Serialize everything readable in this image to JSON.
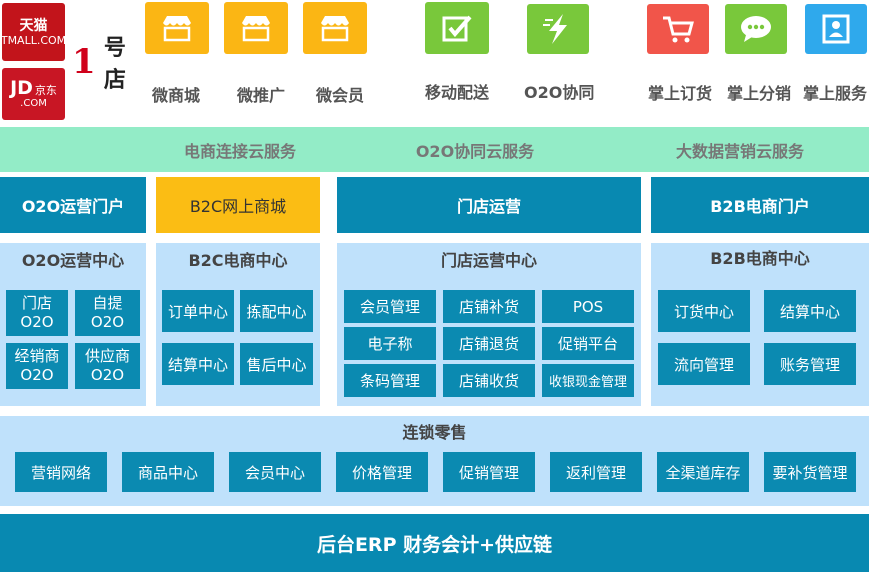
{
  "logos": {
    "tmall_cn": "天猫",
    "tmall_en": "TMALL.COM",
    "jd_en": "JD",
    "jd_cn": "京东",
    "jd_com": ".COM",
    "yhd_one": "1",
    "yhd_rest": "号店"
  },
  "channels": [
    {
      "label": "微商城",
      "icon": "storefront-icon",
      "color": "#fbb614"
    },
    {
      "label": "微推广",
      "icon": "storefront-icon",
      "color": "#fbb614"
    },
    {
      "label": "微会员",
      "icon": "storefront-icon",
      "color": "#fbb614"
    },
    {
      "label": "移动配送",
      "icon": "checkbox-icon",
      "color": "#79c83b"
    },
    {
      "label": "O2O协同",
      "icon": "lightning-icon",
      "color": "#79c83b"
    },
    {
      "label": "掌上订货",
      "icon": "cart-icon",
      "color": "#f1554a"
    },
    {
      "label": "掌上分销",
      "icon": "chat-icon",
      "color": "#79c83b"
    },
    {
      "label": "掌上服务",
      "icon": "contact-card-icon",
      "color": "#2fa9ec"
    }
  ],
  "cloud_services": [
    "电商连接云服务",
    "O2O协同云服务",
    "大数据营销云服务"
  ],
  "portals": [
    "O2O运营门户",
    "B2C网上商城",
    "门店运营",
    "B2B电商门户"
  ],
  "centers": {
    "o2o": {
      "title": "O2O运营中心",
      "items": [
        [
          "门店",
          "O2O"
        ],
        [
          "自提",
          "O2O"
        ],
        [
          "经销商",
          "O2O"
        ],
        [
          "供应商",
          "O2O"
        ]
      ]
    },
    "b2c": {
      "title": "B2C电商中心",
      "items": [
        "订单中心",
        "拣配中心",
        "结算中心",
        "售后中心"
      ]
    },
    "store": {
      "title": "门店运营中心",
      "items": [
        "会员管理",
        "店铺补货",
        "POS",
        "电子称",
        "店铺退货",
        "促销平台",
        "条码管理",
        "店铺收货",
        "收银现金管理"
      ]
    },
    "b2b": {
      "title": "B2B电商中心",
      "items": [
        "订货中心",
        "结算中心",
        "流向管理",
        "账务管理"
      ]
    }
  },
  "chain": {
    "title": "连锁零售",
    "items": [
      "营销网络",
      "商品中心",
      "会员中心",
      "价格管理",
      "促销管理",
      "返利管理",
      "全渠道库存",
      "要补货管理"
    ]
  },
  "erp": "后台ERP 财务会计+供应链",
  "colors": {
    "primary_blue": "#0889b1",
    "light_blue": "#bfe1fb",
    "mint": "#93ecc7",
    "yellow": "#fbbd14",
    "green": "#79c83b",
    "red": "#f1554a",
    "sky": "#2fa9ec"
  }
}
